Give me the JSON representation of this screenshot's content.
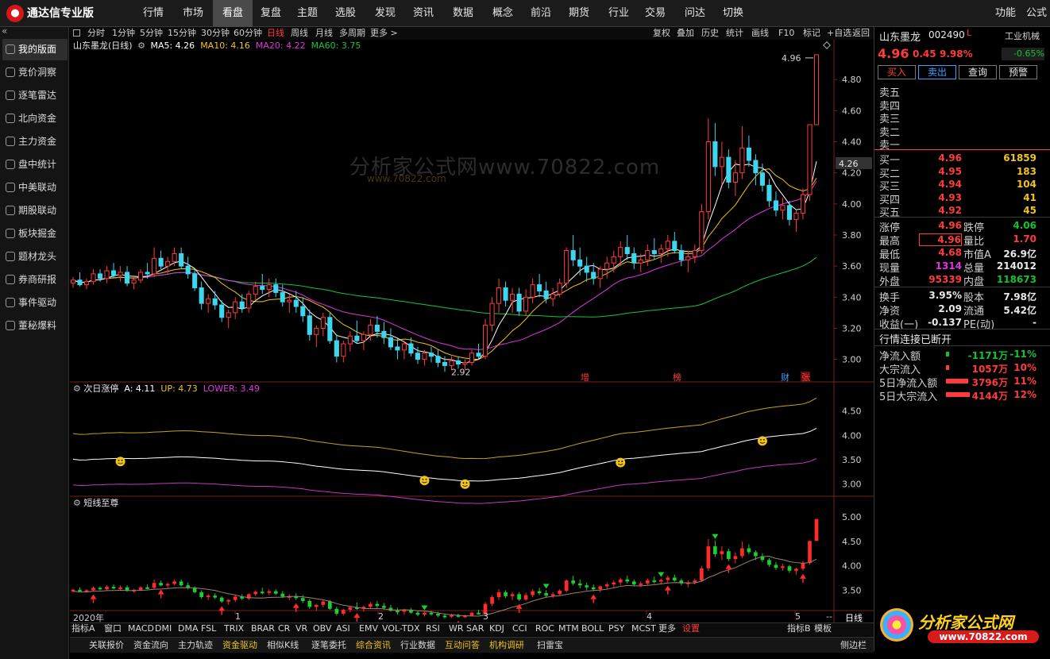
{
  "app": {
    "title": "通达信专业版",
    "logo_icon": "tdx-logo-icon"
  },
  "top_menu": [
    {
      "label": "行情"
    },
    {
      "label": "市场"
    },
    {
      "label": "看盘",
      "active": true
    },
    {
      "label": "复盘"
    },
    {
      "label": "主题"
    },
    {
      "label": "选股"
    },
    {
      "label": "发现"
    },
    {
      "label": "资讯"
    },
    {
      "label": "数据"
    },
    {
      "label": "概念"
    },
    {
      "label": "前沿"
    },
    {
      "label": "期货"
    },
    {
      "label": "行业"
    },
    {
      "label": "交易"
    },
    {
      "label": "问达"
    },
    {
      "label": "切换"
    }
  ],
  "top_right": {
    "func": "功能",
    "pub": "公式"
  },
  "sidebar": {
    "collapse": "«",
    "items": [
      {
        "label": "我的版面",
        "active": true
      },
      {
        "label": "竞价洞察"
      },
      {
        "label": "逐笔雷达"
      },
      {
        "label": "北向资金"
      },
      {
        "label": "主力资金"
      },
      {
        "label": "盘中统计"
      },
      {
        "label": "中美联动"
      },
      {
        "label": "期股联动"
      },
      {
        "label": "板块掘金"
      },
      {
        "label": "题材龙头"
      },
      {
        "label": "券商研报"
      },
      {
        "label": "事件驱动"
      },
      {
        "label": "董秘爆料"
      }
    ]
  },
  "periods": [
    "分时",
    "1分钟",
    "5分钟",
    "15分钟",
    "30分钟",
    "60分钟",
    "日线",
    "周线",
    "月线",
    "多周期",
    "更多 >"
  ],
  "active_period": "日线",
  "toolbar_right": [
    "复权",
    "叠加",
    "历史",
    "统计",
    "画线",
    "F10",
    "标记",
    "+自选",
    "返回"
  ],
  "main_chart": {
    "title": "山东墨龙(日线)",
    "ma": [
      {
        "label": "MA5: 4.26",
        "color": "#ffffff"
      },
      {
        "label": "MA10: 4.16",
        "color": "#f0c419"
      },
      {
        "label": "MA20: 4.22",
        "color": "#e035e0"
      },
      {
        "label": "MA60: 3.75",
        "color": "#19c43a"
      }
    ],
    "high_label": "4.96",
    "low_label": "2.92",
    "current_tag": "4.26",
    "watermark": "分析家公式网www.70822.com",
    "watermark_sub": "www.70822.com",
    "markers": [
      {
        "text": "增"
      },
      {
        "text": "榜"
      },
      {
        "text": "财"
      },
      {
        "text": "张"
      }
    ]
  },
  "sub1": {
    "title": "次日涨停",
    "a": "A: 4.11",
    "up": "UP: 4.73",
    "lower": "LOWER: 3.49"
  },
  "sub2": {
    "title": "短线至尊"
  },
  "time_axis": [
    "2020年",
    "1",
    "2",
    "3",
    "4",
    "5"
  ],
  "axis_buttons": {
    "minus": "--",
    "day": "日线",
    "plus": "+",
    "dash": "-"
  },
  "indicator_tabs": [
    "指标A",
    "窗口",
    "MACD",
    "DMI",
    "DMA",
    "FSL",
    "TRIX",
    "BRAR",
    "CR",
    "VR",
    "OBV",
    "ASI",
    "EMV",
    "VOL-TDX",
    "RSI",
    "WR",
    "SAR",
    "KDJ",
    "CCI",
    "ROC",
    "MTM",
    "BOLL",
    "PSY",
    "MCST",
    "更多",
    "设置"
  ],
  "indicator_right": [
    "指标B",
    "模板"
  ],
  "bottom_tabs": [
    {
      "label": "关联报价",
      "color": "#d8d8d8"
    },
    {
      "label": "资金流向",
      "color": "#d8d8d8"
    },
    {
      "label": "主力轨迹",
      "color": "#d8d8d8"
    },
    {
      "label": "资金驱动",
      "color": "#f0c419"
    },
    {
      "label": "相似K线",
      "color": "#d8d8d8"
    },
    {
      "label": "逐笔委托",
      "color": "#d8d8d8"
    },
    {
      "label": "综合资讯",
      "color": "#f0c419"
    },
    {
      "label": "行业数据",
      "color": "#d8d8d8"
    },
    {
      "label": "互动问答",
      "color": "#f0c419"
    },
    {
      "label": "机构调研",
      "color": "#f0c419"
    },
    {
      "label": "扫雷宝",
      "color": "#d8d8d8"
    }
  ],
  "side_sidebar_btn": "侧边栏",
  "brand_logo": {
    "text": "分析家公式网",
    "url": "www.70822.com"
  },
  "quote": {
    "name": "山东墨龙",
    "code": "002490",
    "flag": "L",
    "industry": "工业机械",
    "price": "4.96",
    "change": "0.45",
    "pct": "9.98%",
    "industry_pct": "-0.65%",
    "buttons": [
      "买入",
      "卖出",
      "查询",
      "预警"
    ],
    "sell_labels": [
      "卖五",
      "卖四",
      "卖三",
      "卖二",
      "卖一"
    ],
    "buy": [
      {
        "label": "买一",
        "price": "4.96",
        "vol": "61859"
      },
      {
        "label": "买二",
        "price": "4.95",
        "vol": "183"
      },
      {
        "label": "买三",
        "price": "4.94",
        "vol": "104"
      },
      {
        "label": "买四",
        "price": "4.93",
        "vol": "41"
      },
      {
        "label": "买五",
        "price": "4.92",
        "vol": "45"
      }
    ],
    "stats": [
      {
        "l1": "涨停",
        "v1": "4.96",
        "c1": "red",
        "l2": "跌停",
        "v2": "4.06",
        "c2": "green"
      },
      {
        "l1": "最高",
        "v1": "4.96",
        "c1": "red",
        "l2": "量比",
        "v2": "1.70",
        "c2": "red"
      },
      {
        "l1": "最低",
        "v1": "4.68",
        "c1": "red",
        "l2": "市值A",
        "v2": "26.9亿",
        "c2": "white"
      },
      {
        "l1": "现量",
        "v1": "1314",
        "c1": "mag",
        "l2": "总量",
        "v2": "214012",
        "c2": "white"
      },
      {
        "l1": "外盘",
        "v1": "95339",
        "c1": "red",
        "l2": "内盘",
        "v2": "118673",
        "c2": "green"
      }
    ],
    "stats2": [
      {
        "l1": "换手",
        "v1": "3.95%",
        "l2": "股本",
        "v2": "7.98亿"
      },
      {
        "l1": "净资",
        "v1": "2.09",
        "l2": "流通",
        "v2": "5.42亿"
      },
      {
        "l1": "收益(一)",
        "v1": "-0.137",
        "l2": "PE(动)",
        "v2": "-"
      }
    ],
    "status": "行情连接已断开",
    "flows": [
      {
        "label": "净流入额",
        "value": "-1171万",
        "pct": "-11%",
        "color": "green"
      },
      {
        "label": "大宗流入",
        "value": "1057万",
        "pct": "10%",
        "color": "red"
      },
      {
        "label": "5日净流入额",
        "value": "3796万",
        "pct": "11%",
        "color": "red"
      },
      {
        "label": "5日大宗流入",
        "value": "4144万",
        "pct": "12%",
        "color": "red"
      }
    ]
  },
  "chart_data": {
    "type": "candlestick",
    "title": "山东墨龙(日线)",
    "y_ticks_main": [
      3.0,
      3.2,
      3.4,
      3.6,
      3.8,
      4.0,
      4.2,
      4.4,
      4.6,
      4.8
    ],
    "y_range_main": [
      2.86,
      4.98
    ],
    "y_ticks_sub1": [
      3.0,
      3.5,
      4.0,
      4.5
    ],
    "y_range_sub1": [
      2.8,
      4.82
    ],
    "y_ticks_sub2": [
      3.5,
      4.0,
      4.5,
      5.0
    ],
    "y_range_sub2": [
      3.1,
      5.15
    ],
    "candles": [
      [
        3.49,
        3.53,
        3.46,
        3.51
      ],
      [
        3.51,
        3.56,
        3.47,
        3.48
      ],
      [
        3.48,
        3.52,
        3.45,
        3.5
      ],
      [
        3.5,
        3.58,
        3.48,
        3.55
      ],
      [
        3.55,
        3.58,
        3.5,
        3.52
      ],
      [
        3.52,
        3.6,
        3.49,
        3.57
      ],
      [
        3.57,
        3.62,
        3.52,
        3.54
      ],
      [
        3.54,
        3.6,
        3.5,
        3.56
      ],
      [
        3.56,
        3.6,
        3.47,
        3.49
      ],
      [
        3.49,
        3.53,
        3.45,
        3.51
      ],
      [
        3.51,
        3.58,
        3.49,
        3.56
      ],
      [
        3.56,
        3.62,
        3.52,
        3.55
      ],
      [
        3.55,
        3.72,
        3.53,
        3.65
      ],
      [
        3.65,
        3.7,
        3.58,
        3.6
      ],
      [
        3.6,
        3.66,
        3.55,
        3.63
      ],
      [
        3.63,
        3.72,
        3.6,
        3.68
      ],
      [
        3.68,
        3.72,
        3.58,
        3.6
      ],
      [
        3.6,
        3.66,
        3.52,
        3.55
      ],
      [
        3.55,
        3.58,
        3.44,
        3.46
      ],
      [
        3.46,
        3.5,
        3.32,
        3.36
      ],
      [
        3.36,
        3.42,
        3.3,
        3.39
      ],
      [
        3.39,
        3.44,
        3.32,
        3.35
      ],
      [
        3.35,
        3.38,
        3.24,
        3.27
      ],
      [
        3.27,
        3.32,
        3.2,
        3.3
      ],
      [
        3.3,
        3.4,
        3.26,
        3.37
      ],
      [
        3.37,
        3.42,
        3.3,
        3.33
      ],
      [
        3.33,
        3.44,
        3.3,
        3.42
      ],
      [
        3.42,
        3.5,
        3.38,
        3.47
      ],
      [
        3.47,
        3.55,
        3.42,
        3.45
      ],
      [
        3.45,
        3.52,
        3.4,
        3.48
      ],
      [
        3.48,
        3.52,
        3.4,
        3.43
      ],
      [
        3.43,
        3.48,
        3.34,
        3.37
      ],
      [
        3.37,
        3.42,
        3.3,
        3.38
      ],
      [
        3.38,
        3.44,
        3.3,
        3.34
      ],
      [
        3.34,
        3.4,
        3.24,
        3.28
      ],
      [
        3.28,
        3.32,
        3.12,
        3.16
      ],
      [
        3.16,
        3.22,
        3.08,
        3.2
      ],
      [
        3.2,
        3.3,
        3.15,
        3.27
      ],
      [
        3.27,
        3.3,
        3.1,
        3.12
      ],
      [
        3.12,
        3.16,
        2.98,
        3.02
      ],
      [
        3.02,
        3.12,
        2.98,
        3.1
      ],
      [
        3.1,
        3.18,
        3.05,
        3.15
      ],
      [
        3.15,
        3.25,
        3.1,
        3.12
      ],
      [
        3.12,
        3.18,
        3.06,
        3.16
      ],
      [
        3.16,
        3.26,
        3.12,
        3.22
      ],
      [
        3.22,
        3.28,
        3.14,
        3.18
      ],
      [
        3.18,
        3.24,
        3.1,
        3.14
      ],
      [
        3.14,
        3.2,
        3.06,
        3.08
      ],
      [
        3.08,
        3.14,
        3.0,
        3.06
      ],
      [
        3.06,
        3.12,
        3.0,
        3.1
      ],
      [
        3.1,
        3.14,
        3.02,
        3.04
      ],
      [
        3.04,
        3.08,
        2.97,
        3.0
      ],
      [
        3.0,
        3.06,
        2.96,
        3.04
      ],
      [
        3.04,
        3.08,
        2.98,
        3.02
      ],
      [
        3.02,
        3.06,
        2.95,
        2.98
      ],
      [
        2.98,
        3.02,
        2.92,
        2.96
      ],
      [
        2.96,
        3.02,
        2.93,
        2.99
      ],
      [
        2.99,
        3.02,
        2.94,
        2.97
      ],
      [
        2.97,
        3.0,
        2.93,
        2.98
      ],
      [
        2.98,
        3.06,
        2.96,
        3.04
      ],
      [
        3.04,
        3.1,
        3.0,
        3.02
      ],
      [
        3.02,
        3.26,
        3.0,
        3.22
      ],
      [
        3.22,
        3.4,
        3.18,
        3.36
      ],
      [
        3.36,
        3.52,
        3.3,
        3.46
      ],
      [
        3.46,
        3.5,
        3.34,
        3.38
      ],
      [
        3.38,
        3.46,
        3.3,
        3.42
      ],
      [
        3.42,
        3.46,
        3.28,
        3.31
      ],
      [
        3.31,
        3.45,
        3.28,
        3.4
      ],
      [
        3.4,
        3.52,
        3.36,
        3.48
      ],
      [
        3.48,
        3.55,
        3.4,
        3.44
      ],
      [
        3.44,
        3.5,
        3.36,
        3.39
      ],
      [
        3.39,
        3.46,
        3.34,
        3.42
      ],
      [
        3.42,
        3.52,
        3.4,
        3.49
      ],
      [
        3.49,
        3.72,
        3.46,
        3.7
      ],
      [
        3.7,
        3.8,
        3.6,
        3.64
      ],
      [
        3.64,
        3.72,
        3.54,
        3.6
      ],
      [
        3.6,
        3.66,
        3.5,
        3.56
      ],
      [
        3.56,
        3.62,
        3.48,
        3.52
      ],
      [
        3.52,
        3.6,
        3.46,
        3.58
      ],
      [
        3.58,
        3.66,
        3.52,
        3.62
      ],
      [
        3.62,
        3.7,
        3.56,
        3.66
      ],
      [
        3.66,
        3.76,
        3.6,
        3.72
      ],
      [
        3.72,
        3.8,
        3.64,
        3.68
      ],
      [
        3.68,
        3.72,
        3.58,
        3.62
      ],
      [
        3.62,
        3.68,
        3.56,
        3.64
      ],
      [
        3.64,
        3.74,
        3.6,
        3.7
      ],
      [
        3.7,
        3.78,
        3.64,
        3.68
      ],
      [
        3.68,
        3.74,
        3.62,
        3.71
      ],
      [
        3.71,
        3.8,
        3.66,
        3.76
      ],
      [
        3.76,
        3.82,
        3.68,
        3.7
      ],
      [
        3.7,
        3.74,
        3.6,
        3.64
      ],
      [
        3.64,
        3.7,
        3.56,
        3.66
      ],
      [
        3.66,
        3.74,
        3.62,
        3.7
      ],
      [
        3.7,
        4.0,
        3.68,
        3.95
      ],
      [
        3.95,
        4.55,
        3.9,
        4.4
      ],
      [
        4.4,
        4.52,
        4.18,
        4.24
      ],
      [
        4.24,
        4.4,
        4.12,
        4.3
      ],
      [
        4.3,
        4.35,
        4.1,
        4.14
      ],
      [
        4.14,
        4.28,
        4.05,
        4.2
      ],
      [
        4.2,
        4.5,
        4.16,
        4.36
      ],
      [
        4.36,
        4.44,
        4.24,
        4.28
      ],
      [
        4.28,
        4.32,
        4.12,
        4.2
      ],
      [
        4.2,
        4.26,
        4.08,
        4.12
      ],
      [
        4.12,
        4.16,
        3.98,
        4.02
      ],
      [
        4.02,
        4.08,
        3.92,
        3.96
      ],
      [
        3.96,
        4.04,
        3.9,
        3.99
      ],
      [
        3.99,
        4.02,
        3.86,
        3.9
      ],
      [
        3.9,
        3.96,
        3.82,
        3.94
      ],
      [
        3.94,
        4.1,
        3.9,
        4.06
      ],
      [
        4.06,
        4.5,
        4.02,
        4.51
      ],
      [
        4.51,
        4.96,
        4.68,
        4.96
      ]
    ],
    "markers_up_sub1": [
      0.06,
      0.47,
      0.53,
      0.74,
      0.93
    ]
  }
}
